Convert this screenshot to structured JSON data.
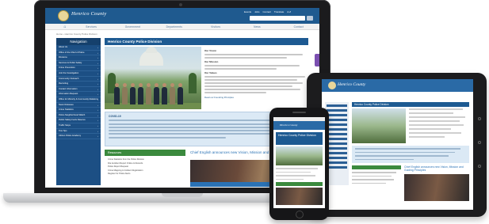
{
  "site": {
    "brand": "Henrico County",
    "top_links": [
      "Events",
      "Jobs",
      "Contact",
      "Translate",
      "A-Z"
    ],
    "nav": [
      "Services",
      "Government",
      "Departments",
      "Visitors",
      "News",
      "Contact"
    ],
    "breadcrumb": "Home › Henrico County Police Division",
    "sidebar_title": "Navigation",
    "sidebar_items": [
      "About Us",
      "Office of the Chief of Police",
      "Divisions",
      "Services & Public Safety",
      "Crime Prevention",
      "Join the Investigation",
      "Community Outreach",
      "Recruiting",
      "Contact Information",
      "Information Request",
      "Office for Minority & Community Relations",
      "News Releases",
      "Crime Statistics",
      "Police Neighborhood Watch",
      "Public Safety Facts Reserve",
      "Traffic Stops",
      "Tow Tips",
      "Citizen Police Academy"
    ],
    "page_title": "Henrico County Police Division",
    "text_headings": [
      "Our Vision",
      "Our Mission",
      "Our Values"
    ],
    "read_more": "Read our Founding Principles",
    "alert_title": "COVID-19",
    "green_title": "Resources",
    "green_items": [
      "Crime Statistics from the Police Division",
      "File Accident Report Online & Records",
      "Police Report Request",
      "Crime Mapping & Incident Registration",
      "Register for Police Alerts"
    ],
    "news_headline": "Chief English announces new Vision, Mission and Guiding Principles"
  },
  "phone": {
    "title": "Henrico County Police Division"
  },
  "colors": {
    "header_blue": "#1f5a8f",
    "sidebar_blue": "#1c4f84",
    "resources_green": "#3b8a3e",
    "alert_bg": "#dbe9f5"
  }
}
